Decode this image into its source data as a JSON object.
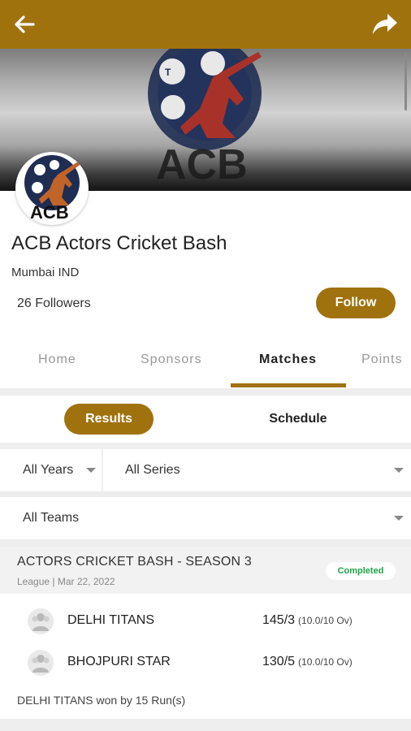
{
  "colors": {
    "accent": "#a0720e",
    "completed": "#1fa34a"
  },
  "topbar": {
    "back_icon": "arrow-left-icon",
    "share_icon": "share-arrow-icon"
  },
  "league": {
    "logo_text": "ACB",
    "name": "ACB Actors Cricket Bash",
    "location": "Mumbai IND",
    "followers": "26 Followers",
    "follow_label": "Follow"
  },
  "tabs": [
    {
      "label": "Home",
      "active": false
    },
    {
      "label": "Sponsors",
      "active": false
    },
    {
      "label": "Matches",
      "active": true
    },
    {
      "label": "Points",
      "active": false
    }
  ],
  "segment": {
    "results_label": "Results",
    "schedule_label": "Schedule",
    "selected": "Results"
  },
  "filters": {
    "years": "All Years",
    "series": "All Series",
    "teams": "All Teams"
  },
  "match": {
    "series_title": "ACTORS CRICKET BASH - SEASON 3",
    "subtitle": "League | Mar 22, 2022",
    "status": "Completed",
    "teams": [
      {
        "name": "DELHI TITANS",
        "score": "145/3",
        "overs": "(10.0/10 Ov)"
      },
      {
        "name": "BHOJPURI STAR",
        "score": "130/5",
        "overs": "(10.0/10 Ov)"
      }
    ],
    "result": "DELHI TITANS won by 15 Run(s)"
  }
}
